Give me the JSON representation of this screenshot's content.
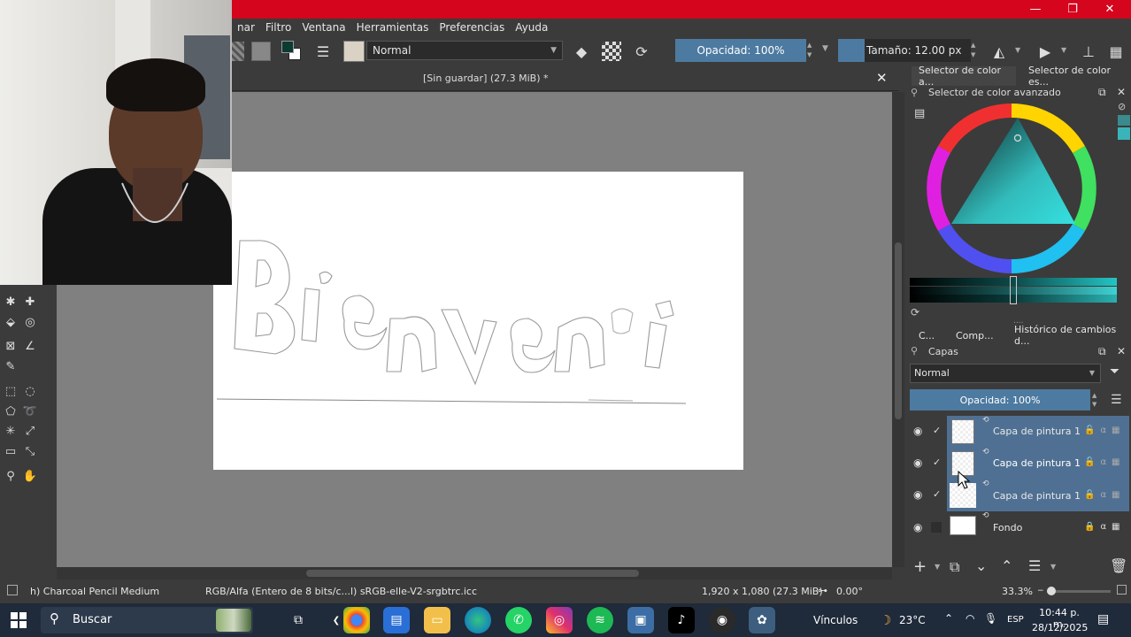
{
  "window": {
    "min": "—",
    "restore": "❐",
    "close": "✕"
  },
  "menubar": [
    "nar",
    "Filtro",
    "Ventana",
    "Herramientas",
    "Preferencias",
    "Ayuda"
  ],
  "toolbar": {
    "blend_mode": "Normal",
    "opacity": "Opacidad: 100%",
    "size": "Tamaño: 12.00 px"
  },
  "document": {
    "title": "[Sin guardar]  (27.3 MiB) *"
  },
  "drawing": {
    "text": "Bienvenidi"
  },
  "color_panel": {
    "tab1": "Selector de color a...",
    "tab2": "Selector de color es...",
    "title": "Selector de color avanzado"
  },
  "layers_panel": {
    "tab1": "C...",
    "tab2": "Comp...",
    "tab3": "Histórico de cambios d...",
    "title": "Capas",
    "blend": "Normal",
    "opacity": "Opacidad:  100%",
    "layers": [
      {
        "name": "Capa de pintura 1"
      },
      {
        "name": "Capa de pintura 1"
      },
      {
        "name": "Capa de pintura 1"
      },
      {
        "name": "Fondo"
      }
    ]
  },
  "status": {
    "brush": "h) Charcoal Pencil Medium",
    "colorspace": "RGB/Alfa (Entero de 8 bits/c...l)  sRGB-elle-V2-srgbtrc.icc",
    "dims": "1,920 x 1,080 (27.3 MiB)",
    "rotation": "0.00°",
    "zoom": "33.3%"
  },
  "taskbar": {
    "search": "Buscar",
    "links": "Vínculos",
    "weather": "23°C",
    "lang": "ESP",
    "time": "10:44 p. m.",
    "date": "28/12/2025"
  }
}
